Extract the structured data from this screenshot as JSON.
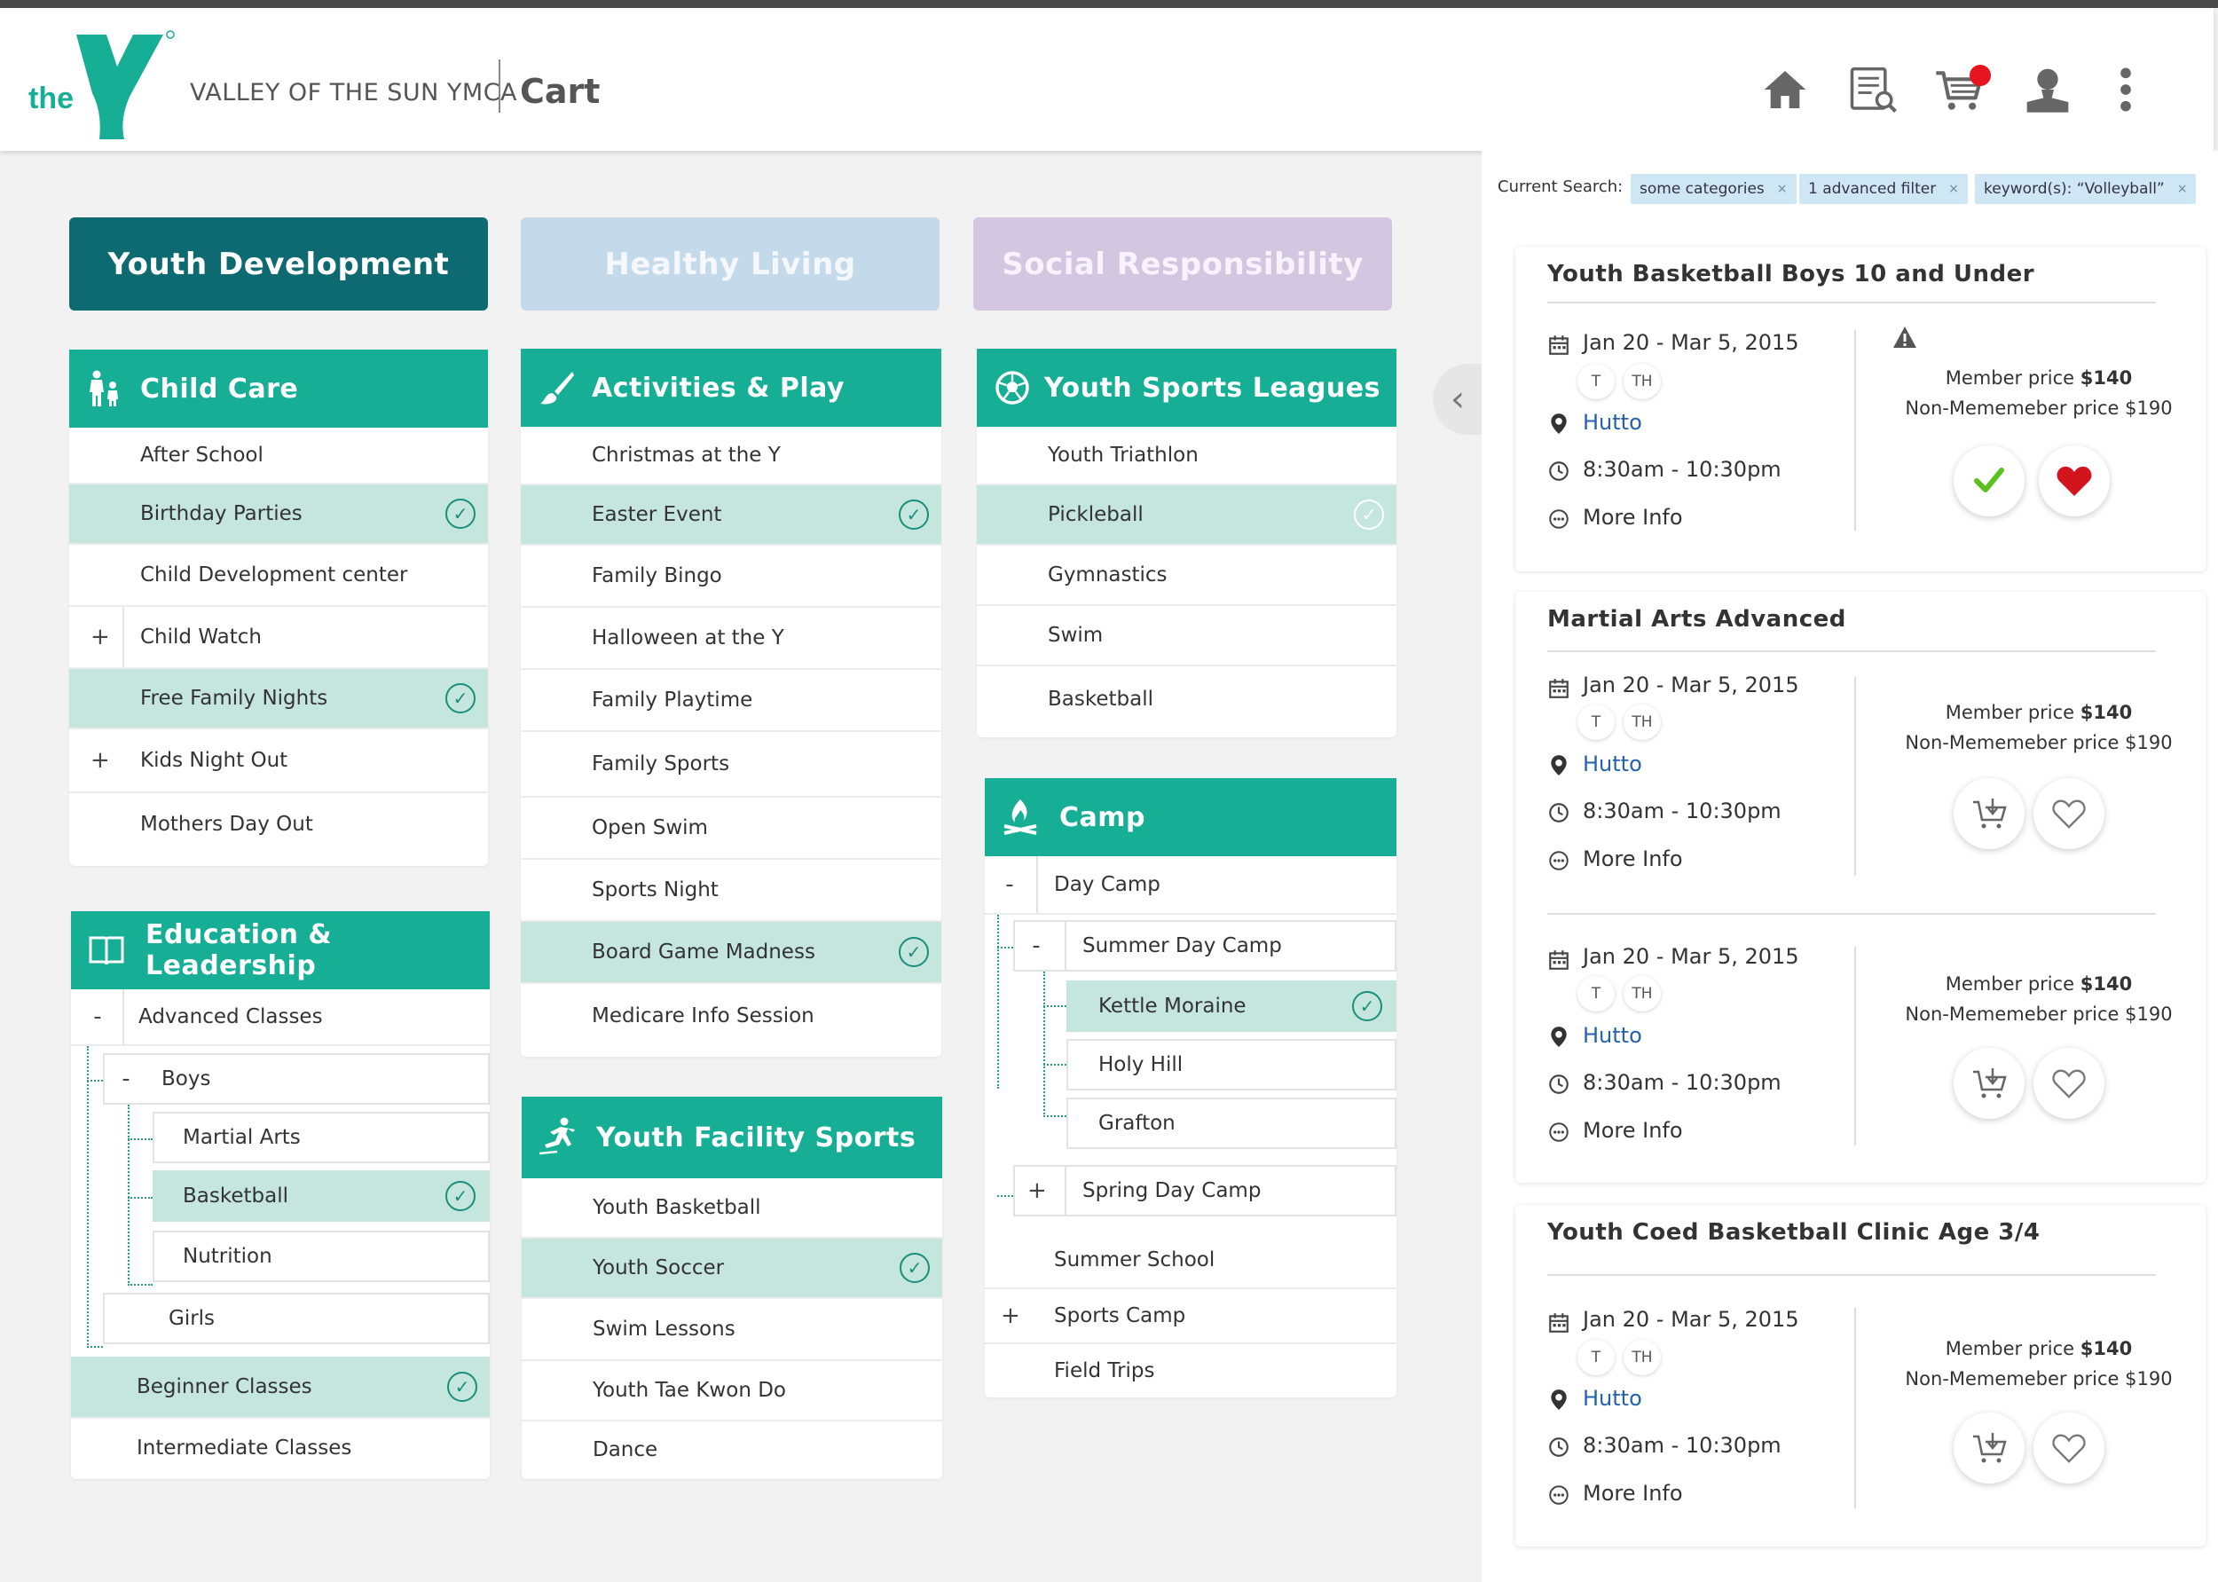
{
  "header": {
    "logo_text": "the",
    "logo_sub": "YMCA",
    "org_name": "VALLEY OF THE SUN YMCA",
    "page_title": "Cart",
    "icons": [
      "home-icon",
      "search-list-icon",
      "cart-icon",
      "user-icon",
      "more-vertical-icon"
    ]
  },
  "categories": [
    "Youth Development",
    "Healthy Living",
    "Social Responsibility"
  ],
  "panels": {
    "child_care": {
      "title": "Child Care",
      "items": [
        "After School",
        "Birthday Parties",
        "Child Development center",
        "Child Watch",
        "Free Family Nights",
        "Kids Night Out",
        "Mothers Day Out"
      ]
    },
    "education": {
      "title": "Education & Leadership",
      "items": [
        "Advanced Classes",
        "Boys",
        "Martial Arts",
        "Basketball",
        "Nutrition",
        "Girls",
        "Beginner Classes",
        "Intermediate Classes"
      ]
    },
    "activities": {
      "title": "Activities & Play",
      "items": [
        "Christmas at the Y",
        "Easter Event",
        "Family Bingo",
        "Halloween at the Y",
        "Family Playtime",
        "Family Sports",
        "Open Swim",
        "Sports Night",
        "Board Game Madness",
        "Medicare Info Session"
      ]
    },
    "facility": {
      "title": "Youth Facility Sports",
      "items": [
        "Youth Basketball",
        "Youth Soccer",
        "Swim Lessons",
        "Youth Tae Kwon Do",
        "Dance"
      ]
    },
    "leagues": {
      "title": "Youth Sports Leagues",
      "items": [
        "Youth Triathlon",
        "Pickleball",
        "Gymnastics",
        "Swim",
        "Basketball"
      ]
    },
    "camp": {
      "title": "Camp",
      "items": [
        "Day Camp",
        "Summer Day Camp",
        "Kettle Moraine",
        "Holy Hill",
        "Grafton",
        "Spring Day Camp",
        "Summer School",
        "Sports Camp",
        "Field Trips"
      ]
    }
  },
  "toggles": {
    "plus": "+",
    "minus": "-",
    "check": "✓"
  },
  "search": {
    "label": "Current Search:",
    "chips": [
      "some categories",
      "1 advanced filter",
      "keyword(s): “Volleyball”"
    ],
    "chip_close": "×"
  },
  "collapse_glyph": "‹",
  "results": [
    {
      "title": "Youth Basketball Boys 10 and Under",
      "date": "Jan 20 - Mar 5, 2015",
      "days": [
        "T",
        "TH"
      ],
      "location": "Hutto",
      "time": "8:30am - 10:30pm",
      "more": "More Info",
      "member_label": "Member price ",
      "member_price": "$140",
      "nonmember": "Non-Mememeber price $190",
      "state": "added"
    },
    {
      "title": "Martial Arts Advanced",
      "sessions": [
        {
          "date": "Jan 20 - Mar 5, 2015",
          "days": [
            "T",
            "TH"
          ],
          "location": "Hutto",
          "time": "8:30am - 10:30pm",
          "more": "More Info",
          "member_label": "Member price ",
          "member_price": "$140",
          "nonmember": "Non-Mememeber price $190"
        },
        {
          "date": "Jan 20 - Mar 5, 2015",
          "days": [
            "T",
            "TH"
          ],
          "location": "Hutto",
          "time": "8:30am - 10:30pm",
          "more": "More Info",
          "member_label": "Member price ",
          "member_price": "$140",
          "nonmember": "Non-Mememeber price $190"
        }
      ]
    },
    {
      "title": "Youth Coed Basketball Clinic Age 3/4",
      "date": "Jan 20 - Mar 5, 2015",
      "days": [
        "T",
        "TH"
      ],
      "location": "Hutto",
      "time": "8:30am - 10:30pm",
      "more": "More Info",
      "member_label": "Member price ",
      "member_price": "$140",
      "nonmember": "Non-Mememeber price $190"
    }
  ],
  "colors": {
    "teal": "#17ae96",
    "dark_teal": "#0e6a71",
    "selected_row": "#c5e6dd",
    "healthy_living": "#c4d9e9",
    "social_resp": "#d3c6e1",
    "cart_badge": "#e5141e",
    "link": "#2360ad"
  }
}
